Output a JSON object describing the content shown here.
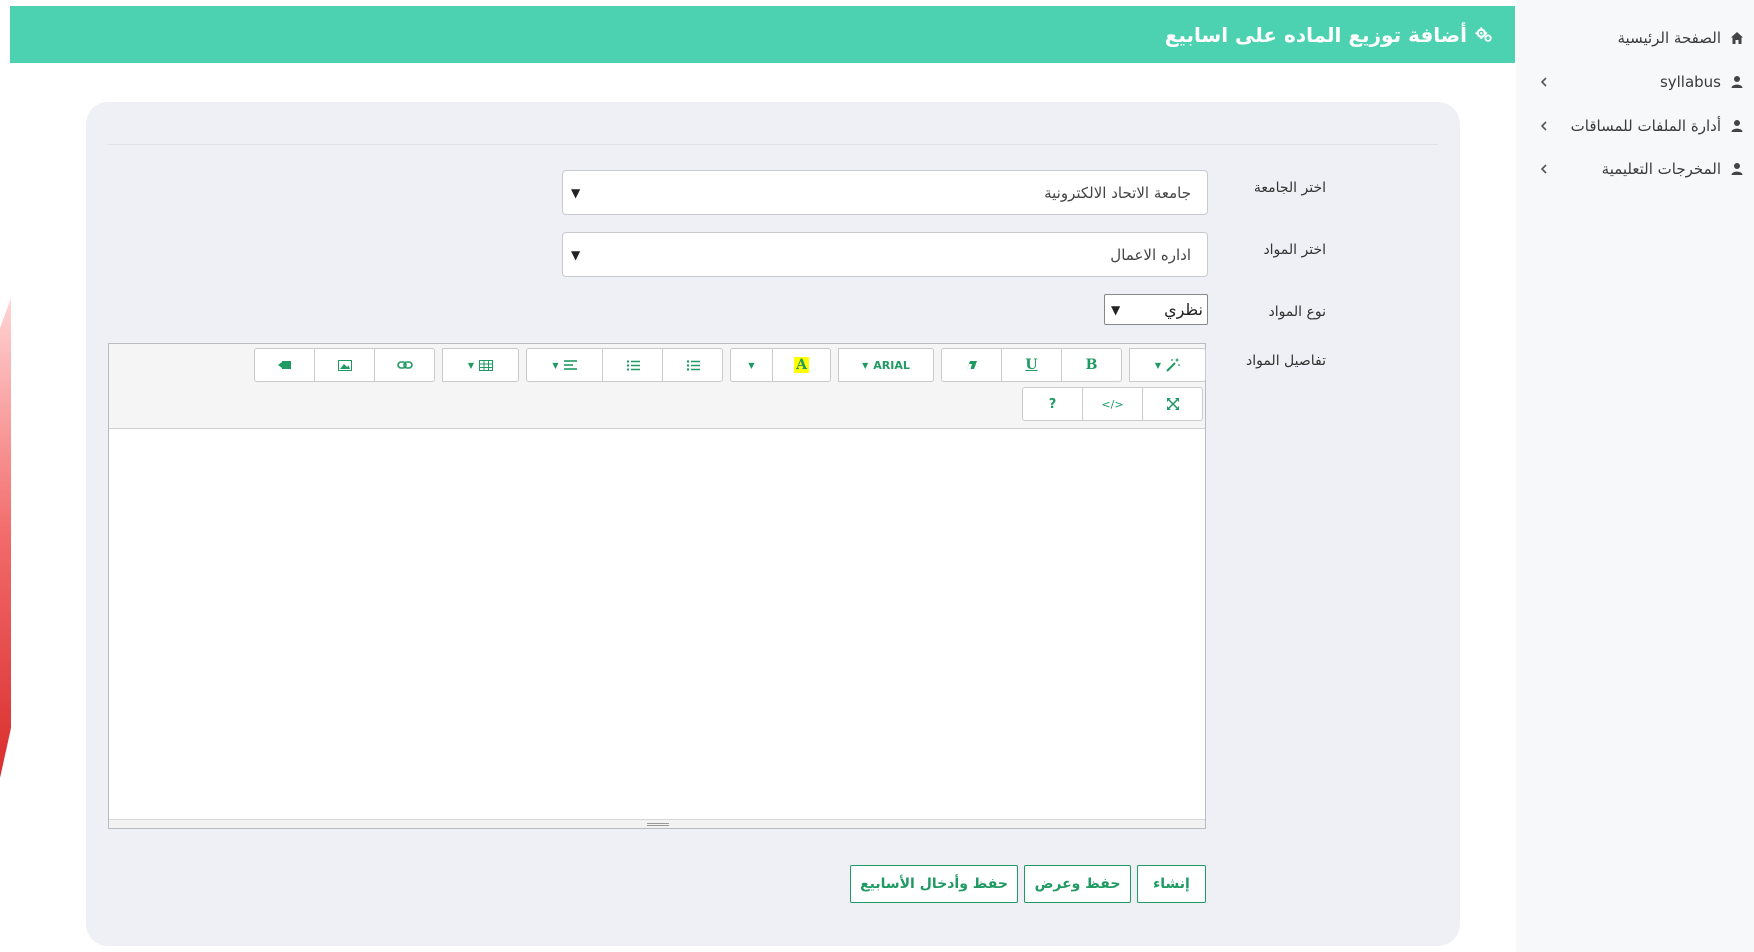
{
  "header": {
    "title": "أضافة توزيع الماده على اسابيع",
    "icon": "cogs-icon"
  },
  "sidebar": {
    "items": [
      {
        "label": "الصفحة الرئيسية",
        "icon": "home-icon",
        "has_chevron": false
      },
      {
        "label": "syllabus",
        "icon": "user-icon",
        "has_chevron": true
      },
      {
        "label": "أدارة الملفات للمساقات",
        "icon": "user-icon",
        "has_chevron": true
      },
      {
        "label": "المخرجات التعليمية",
        "icon": "user-icon",
        "has_chevron": true
      }
    ]
  },
  "form": {
    "university": {
      "label": "اختر الجامعة",
      "value": "جامعة الاتحاد الالكترونية"
    },
    "subject": {
      "label": "اختر المواد",
      "value": "اداره الاعمال"
    },
    "subject_type": {
      "label": "نوع المواد",
      "value": "نظري"
    },
    "details": {
      "label": "تفاصيل المواد",
      "content": ""
    }
  },
  "editor": {
    "font_name": "ARIAL",
    "highlight_glyph": "A",
    "bold_glyph": "B",
    "underline_glyph": "U",
    "help_glyph": "?",
    "code_glyph": "</>"
  },
  "actions": {
    "create": "إنشاء",
    "save_view": "حفظ وعرض",
    "save_weeks": "حفظ وأدخال الأسابيع"
  },
  "colors": {
    "header_bg": "#4dd2b1",
    "accent": "#1f9a63",
    "card_bg": "#eff0f5"
  }
}
